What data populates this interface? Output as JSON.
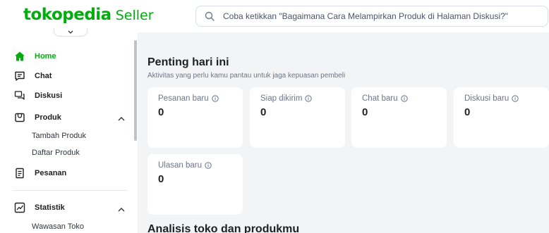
{
  "header": {
    "logo_main": "tokopedia",
    "logo_sub": "Seller",
    "search_placeholder": "Coba ketikkan \"Bagaimana Cara Melampirkan Produk di Halaman Diskusi?\""
  },
  "sidebar": {
    "home": "Home",
    "chat": "Chat",
    "diskusi": "Diskusi",
    "produk": "Produk",
    "produk_sub": [
      "Tambah Produk",
      "Daftar Produk"
    ],
    "pesanan": "Pesanan",
    "statistik": "Statistik",
    "statistik_sub": [
      "Wawasan Toko"
    ]
  },
  "main": {
    "title": "Penting hari ini",
    "subtitle": "Aktivitas yang perlu kamu pantau untuk jaga kepuasan pembeli",
    "cards": [
      {
        "label": "Pesanan baru",
        "value": "0"
      },
      {
        "label": "Siap dikirim",
        "value": "0"
      },
      {
        "label": "Chat baru",
        "value": "0"
      },
      {
        "label": "Diskusi baru",
        "value": "0"
      },
      {
        "label": "Ulasan baru",
        "value": "0"
      }
    ],
    "analysis_title": "Analisis toko dan produkmu"
  },
  "colors": {
    "brand": "#03AC0E",
    "background": "#f3f4f5"
  }
}
